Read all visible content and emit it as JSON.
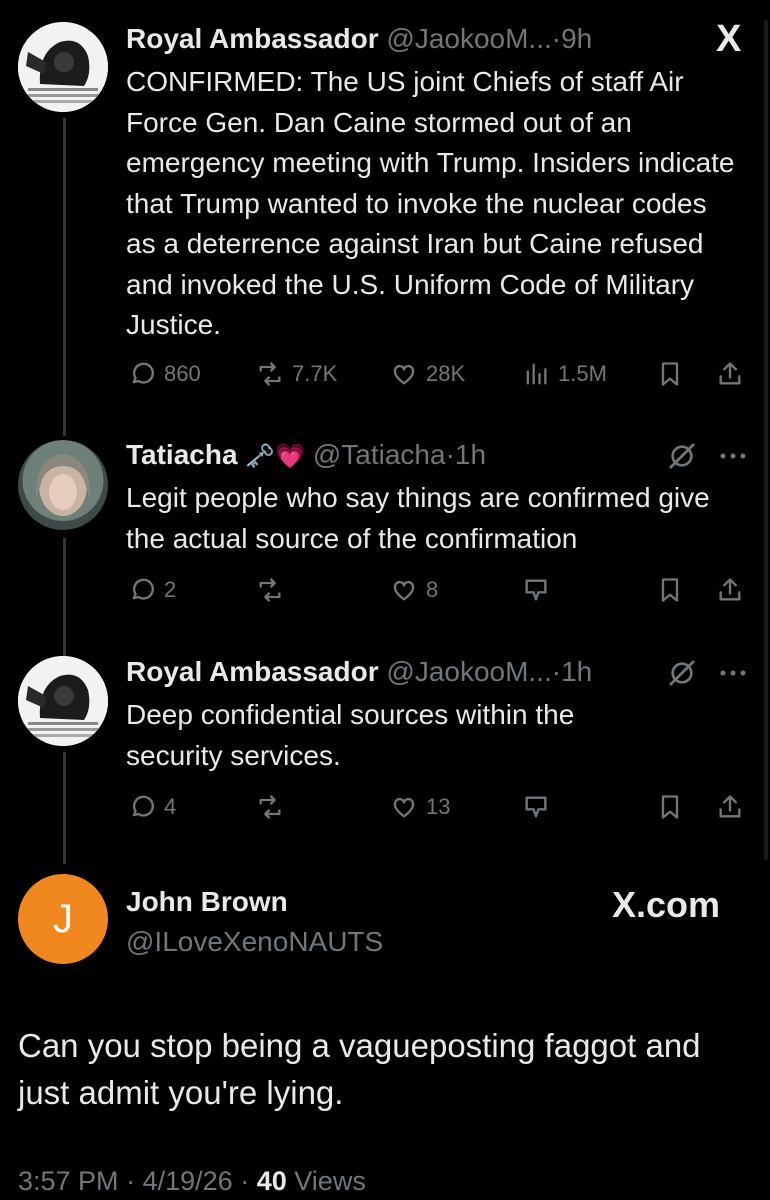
{
  "posts": [
    {
      "author": "Royal Ambassador",
      "handle": "@JaokooM...",
      "time": "9h",
      "text": "CONFIRMED: The US joint Chiefs of staff Air Force Gen. Dan Caine stormed out of an emergency meeting with Trump. Insiders indicate that Trump wanted to invoke the nuclear codes as a deterrence against Iran but Caine refused and invoked the U.S. Uniform Code of Military Justice.",
      "replies": "860",
      "reposts": "7.7K",
      "likes": "28K",
      "views": "1.5M"
    },
    {
      "author": "Tatiacha",
      "name_emojis": "🗝️💗",
      "handle": "@Tatiacha",
      "time": "1h",
      "text": "Legit people who say things are confirmed give the actual source of the confirmation",
      "replies": "2",
      "likes": "8"
    },
    {
      "author": "Royal Ambassador",
      "handle": "@JaokooM...",
      "time": "1h",
      "text": "Deep confidential sources within the security services.",
      "replies": "4",
      "likes": "13"
    }
  ],
  "reply": {
    "avatar_letter": "J",
    "author": "John Brown",
    "handle": "@ILoveXenoNAUTS",
    "brand": "X.com",
    "text": "Can you stop being a vagueposting faggot and just admit you're lying.",
    "time": "3:57 PM",
    "date": "4/19/26",
    "views_count": "40",
    "views_label": "Views"
  },
  "icons": {
    "close": "X",
    "separator": "·"
  },
  "colors": {
    "background": "#000000",
    "text": "#e7e9ea",
    "muted": "#71767b",
    "avatar_orange": "#f1871f"
  }
}
